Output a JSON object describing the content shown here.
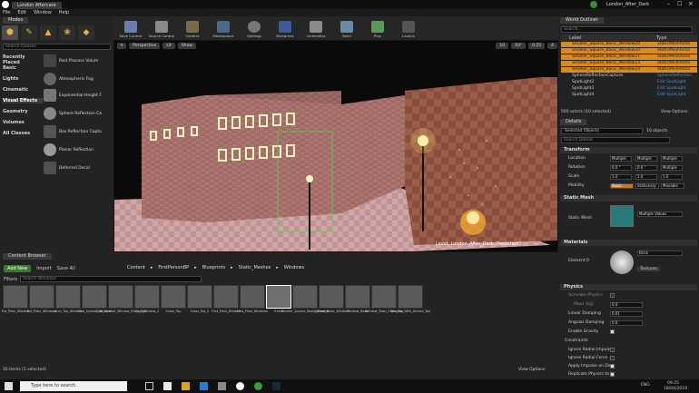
{
  "window": {
    "tab": "London Aftercare",
    "project": "London_After_Dark"
  },
  "menu": [
    "File",
    "Edit",
    "Window",
    "Help"
  ],
  "modes": {
    "tab": "Modes",
    "search_placeholder": "Search Classes",
    "categories": [
      "Recently Placed",
      "Basic",
      "Lights",
      "Cinematic",
      "Visual Effects",
      "Geometry",
      "Volumes",
      "All Classes"
    ],
    "selected_category": "Visual Effects",
    "items": [
      "Post Process Volum",
      "Atmospheric Fog",
      "Exponential Height F",
      "Sphere Reflection Ca",
      "Box Reflection Captu",
      "Planar Reflection",
      "Deferred Decal"
    ]
  },
  "toolbar": [
    "Save Current",
    "Source Control",
    "Content",
    "Marketplace",
    "Settings",
    "Blueprints",
    "Cinematics",
    "Build",
    "Play",
    "Launch"
  ],
  "viewport": {
    "perspective": "Perspective",
    "lit": "Lit",
    "show": "Show",
    "level_label": "Level: London_After_Dark (Persistent)",
    "snap": "10",
    "angle": "10°",
    "scale": "0.25",
    "cam": "4"
  },
  "outliner": {
    "tab": "World Outliner",
    "search_placeholder": "Search...",
    "col_label": "Label",
    "col_type": "Type",
    "rows": [
      {
        "label": "Smaller_Square_Basic_Window20",
        "type": "StaticMeshActor"
      },
      {
        "label": "Smaller_Square_Basic_Window20",
        "type": "StaticMeshActor"
      },
      {
        "label": "Smaller_Square_Basic_Window21",
        "type": "StaticMeshActor"
      },
      {
        "label": "Smaller_Square_Basic_Window23",
        "type": "StaticMeshActor"
      },
      {
        "label": "Smaller_Square_Basic_Window24",
        "type": "StaticMeshActor"
      },
      {
        "label": "SphereReflectionCapture",
        "type": "SphereReflection"
      },
      {
        "label": "SpotLight2",
        "type": "Edit SpotLight"
      },
      {
        "label": "SpotLight3",
        "type": "Edit SpotLight"
      },
      {
        "label": "SpotLight4",
        "type": "Edit SpotLight"
      }
    ],
    "status": "500 actors (10 selected)",
    "view_options": "View Options"
  },
  "details": {
    "tab": "Details",
    "selected": "Selected Objects",
    "count": "10 objects",
    "search_placeholder": "Search Details",
    "transform": "Transform",
    "location": "Location",
    "rotation": "Rotation",
    "scale": "Scale",
    "mobility": "Mobility",
    "multiple": "Multiple",
    "rot_val": "0.0 °",
    "scale_val": "1.0",
    "mob": [
      "Static",
      "Stationary",
      "Movable"
    ],
    "static_mesh": "Static Mesh",
    "static_mesh_label": "Static Mesh",
    "mesh_value": "Multiple Values",
    "materials": "Materials",
    "element": "Element 0",
    "mat_value": "Brick",
    "textures": "Textures",
    "physics": "Physics",
    "simulate": "Simulate Physics",
    "mass": "Mass (kg)",
    "mass_val": "0.0",
    "linear": "Linear Damping",
    "linear_val": "0.01",
    "angular": "Angular Damping",
    "angular_val": "0.0",
    "gravity": "Enable Gravity",
    "constraints": "Constraints",
    "ignore_radial_impulse": "Ignore Radial Impulse",
    "ignore_radial_force": "Ignore Radial Force",
    "apply_impulse": "Apply Impulse on Dam",
    "replicate": "Replicate Physics to A"
  },
  "content": {
    "tab": "Content Browser",
    "add_new": "Add New",
    "import": "Import",
    "save_all": "Save All",
    "breadcrumb": [
      "Content",
      "FirstPersonBP",
      "Blueprints",
      "Static_Meshes",
      "Windows"
    ],
    "filters": "Filters",
    "search_placeholder": "Search Windows",
    "assets": [
      "Ent_Plain_Window",
      "Ent_Plain_Windows",
      "Arch_Top_Window",
      "Club_Symbol_Window",
      "Club_Symbol_Window_Entry_Top",
      "Club_Window_2",
      "Crass_Top",
      "Crass_Top_2",
      "First_Plain_Window",
      "First_Plain_Windows",
      "Frame",
      "Smaller_Square_Basic_Window",
      "Square_Basic_Window",
      "Window_Basic",
      "Window_Town_Crass_Top",
      "Window_With_Arched_Top"
    ],
    "selected_asset": "Frame",
    "status": "16 items (1 selected)",
    "view_options": "View Options"
  },
  "taskbar": {
    "search": "Type here to search",
    "time": "09:25",
    "date": "18/04/2019",
    "lang": "ENG"
  }
}
